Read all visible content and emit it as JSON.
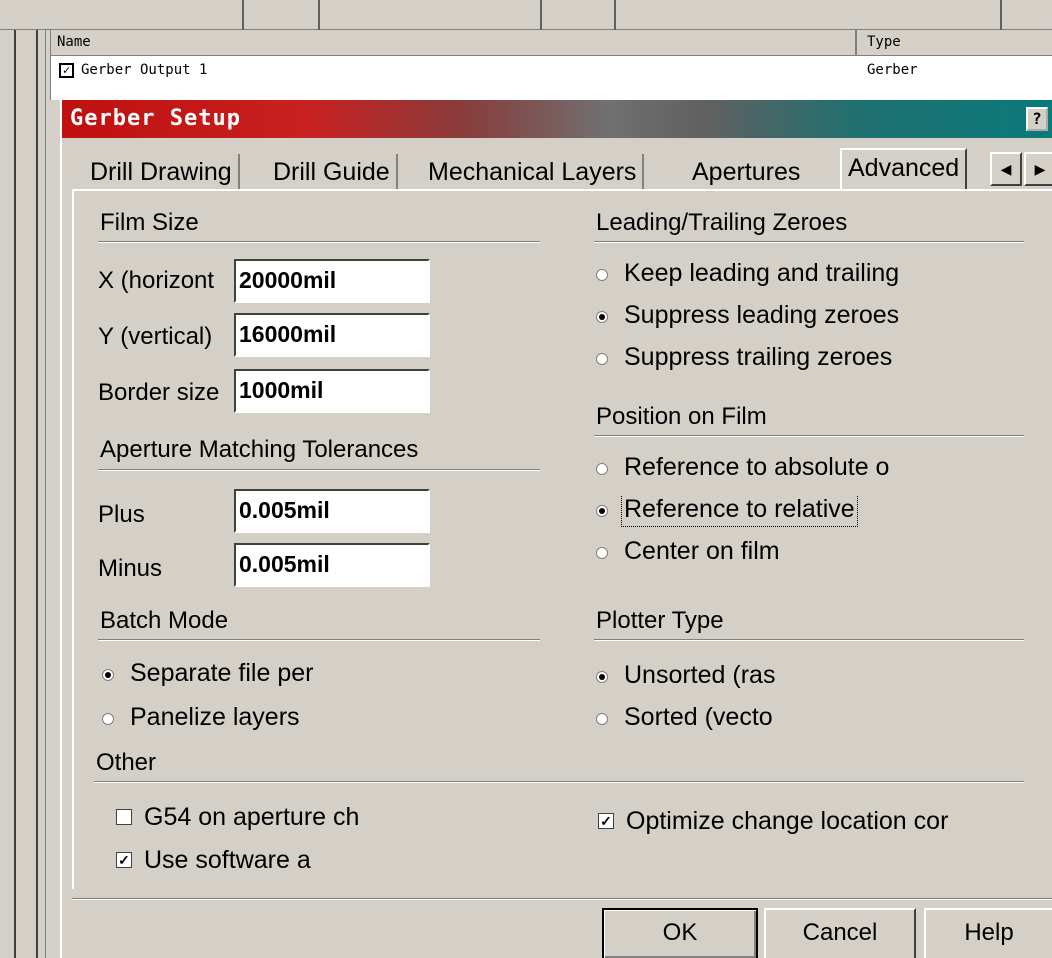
{
  "background": {
    "list": {
      "columns": [
        "Name",
        "Type"
      ],
      "rows": [
        {
          "checked": true,
          "name": "Gerber Output 1",
          "type": "Gerber"
        }
      ]
    }
  },
  "dialog": {
    "title": "Gerber Setup",
    "help_glyph": "?",
    "tabs": [
      "Drill Drawing",
      "Drill Guide",
      "Mechanical Layers",
      "Apertures",
      "Advanced"
    ],
    "active_tab": "Advanced",
    "film_size": {
      "title": "Film Size",
      "x_label": "X (horizont",
      "x_value": "20000mil",
      "y_label": "Y (vertical)",
      "y_value": "16000mil",
      "border_label": "Border size",
      "border_value": "1000mil"
    },
    "aperture_tolerances": {
      "title": "Aperture Matching Tolerances",
      "plus_label": "Plus",
      "plus_value": "0.005mil",
      "minus_label": "Minus",
      "minus_value": "0.005mil"
    },
    "batch_mode": {
      "title": "Batch Mode",
      "options": [
        "Separate file per",
        "Panelize layers"
      ],
      "selected": 0
    },
    "zeroes": {
      "title": "Leading/Trailing Zeroes",
      "options": [
        "Keep leading and trailing",
        "Suppress leading zeroes",
        "Suppress trailing zeroes"
      ],
      "selected": 1
    },
    "position": {
      "title": "Position on Film",
      "options": [
        "Reference to absolute o",
        "Reference to relative",
        "Center on film"
      ],
      "selected": 1
    },
    "plotter": {
      "title": "Plotter Type",
      "options": [
        "Unsorted (ras",
        "Sorted (vecto"
      ],
      "selected": 0
    },
    "other": {
      "title": "Other",
      "g54_label": "G54 on aperture ch",
      "g54_checked": false,
      "software_label": "Use software a",
      "software_checked": true,
      "optimize_label": "Optimize change location cor",
      "optimize_checked": true
    },
    "buttons": {
      "ok": "OK",
      "cancel": "Cancel",
      "help": "Help"
    }
  }
}
